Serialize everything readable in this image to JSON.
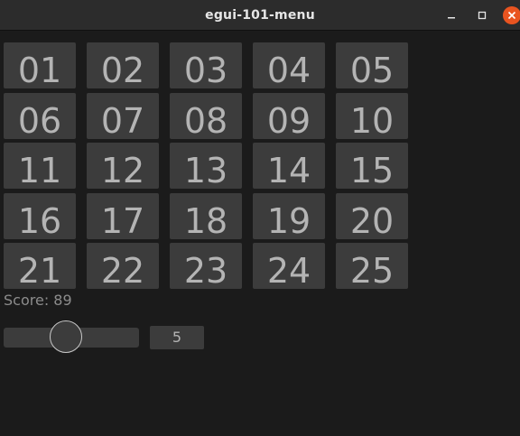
{
  "window": {
    "title": "egui-101-menu",
    "controls": {
      "minimize_icon": "minimize-icon",
      "maximize_icon": "maximize-icon",
      "close_icon": "close-icon",
      "close_color": "#e95420"
    }
  },
  "grid": {
    "cells": [
      "01",
      "02",
      "03",
      "04",
      "05",
      "06",
      "07",
      "08",
      "09",
      "10",
      "11",
      "12",
      "13",
      "14",
      "15",
      "16",
      "17",
      "18",
      "19",
      "20",
      "21",
      "22",
      "23",
      "24",
      "25"
    ]
  },
  "score": {
    "label": "Score:",
    "value": "89"
  },
  "slider": {
    "value": "5",
    "min": 1,
    "max": 10
  },
  "colors": {
    "background": "#1b1b1b",
    "titlebar": "#2c2c2c",
    "cell": "#3c3c3c",
    "cell_text": "#b4b4b4",
    "muted_text": "#8c8c8c"
  }
}
